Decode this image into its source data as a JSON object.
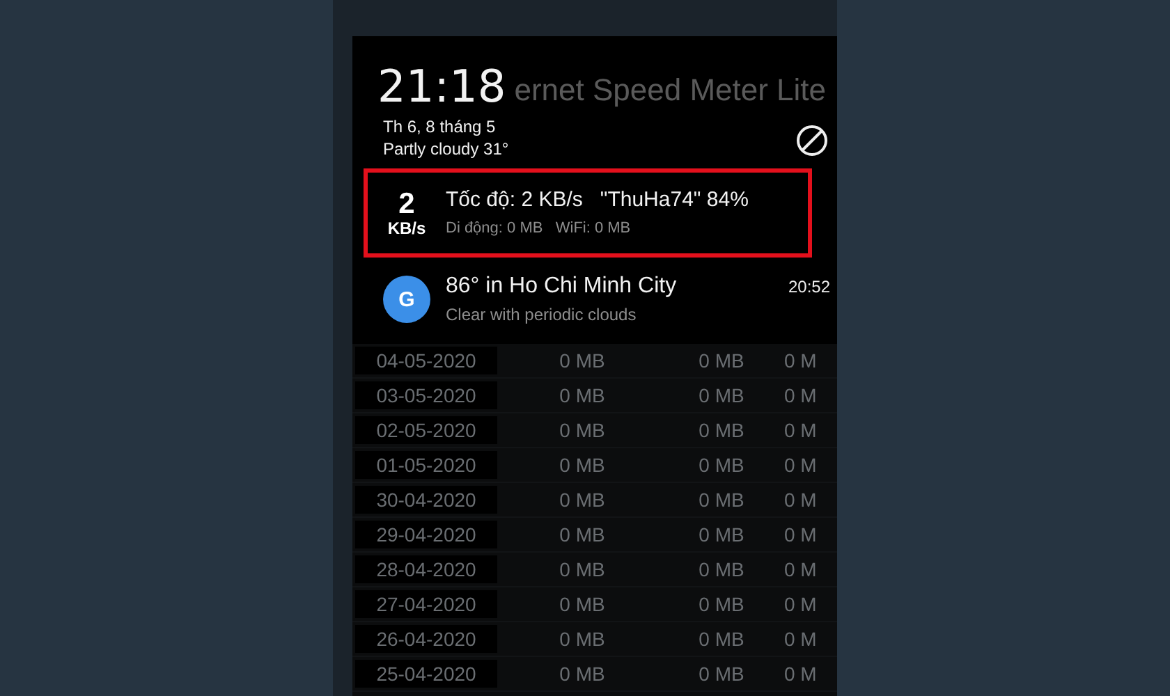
{
  "app": {
    "title": "ernet Speed Meter Lite"
  },
  "lock": {
    "time": "21:18",
    "date": "Th 6, 8 tháng 5",
    "weather": "Partly cloudy 31°"
  },
  "notifications": [
    {
      "kind": "speed",
      "highlighted": true,
      "badge_value": "2",
      "badge_unit": "KB/s",
      "title": "Tốc độ: 2 KB/s   \"ThuHa74\" 84%",
      "text": "Di động: 0 MB   WiFi: 0 MB"
    },
    {
      "kind": "google",
      "highlighted": false,
      "icon_letter": "G",
      "title": "86° in Ho Chi Minh City",
      "time": "20:52",
      "text": "Clear with periodic clouds"
    }
  ],
  "table": {
    "rows": [
      [
        "04-05-2020",
        "0 MB",
        "0 MB",
        "0 M"
      ],
      [
        "03-05-2020",
        "0 MB",
        "0 MB",
        "0 M"
      ],
      [
        "02-05-2020",
        "0 MB",
        "0 MB",
        "0 M"
      ],
      [
        "01-05-2020",
        "0 MB",
        "0 MB",
        "0 M"
      ],
      [
        "30-04-2020",
        "0 MB",
        "0 MB",
        "0 M"
      ],
      [
        "29-04-2020",
        "0 MB",
        "0 MB",
        "0 M"
      ],
      [
        "28-04-2020",
        "0 MB",
        "0 MB",
        "0 M"
      ],
      [
        "27-04-2020",
        "0 MB",
        "0 MB",
        "0 M"
      ],
      [
        "26-04-2020",
        "0 MB",
        "0 MB",
        "0 M"
      ],
      [
        "25-04-2020",
        "0 MB",
        "0 MB",
        "0 M"
      ]
    ]
  }
}
